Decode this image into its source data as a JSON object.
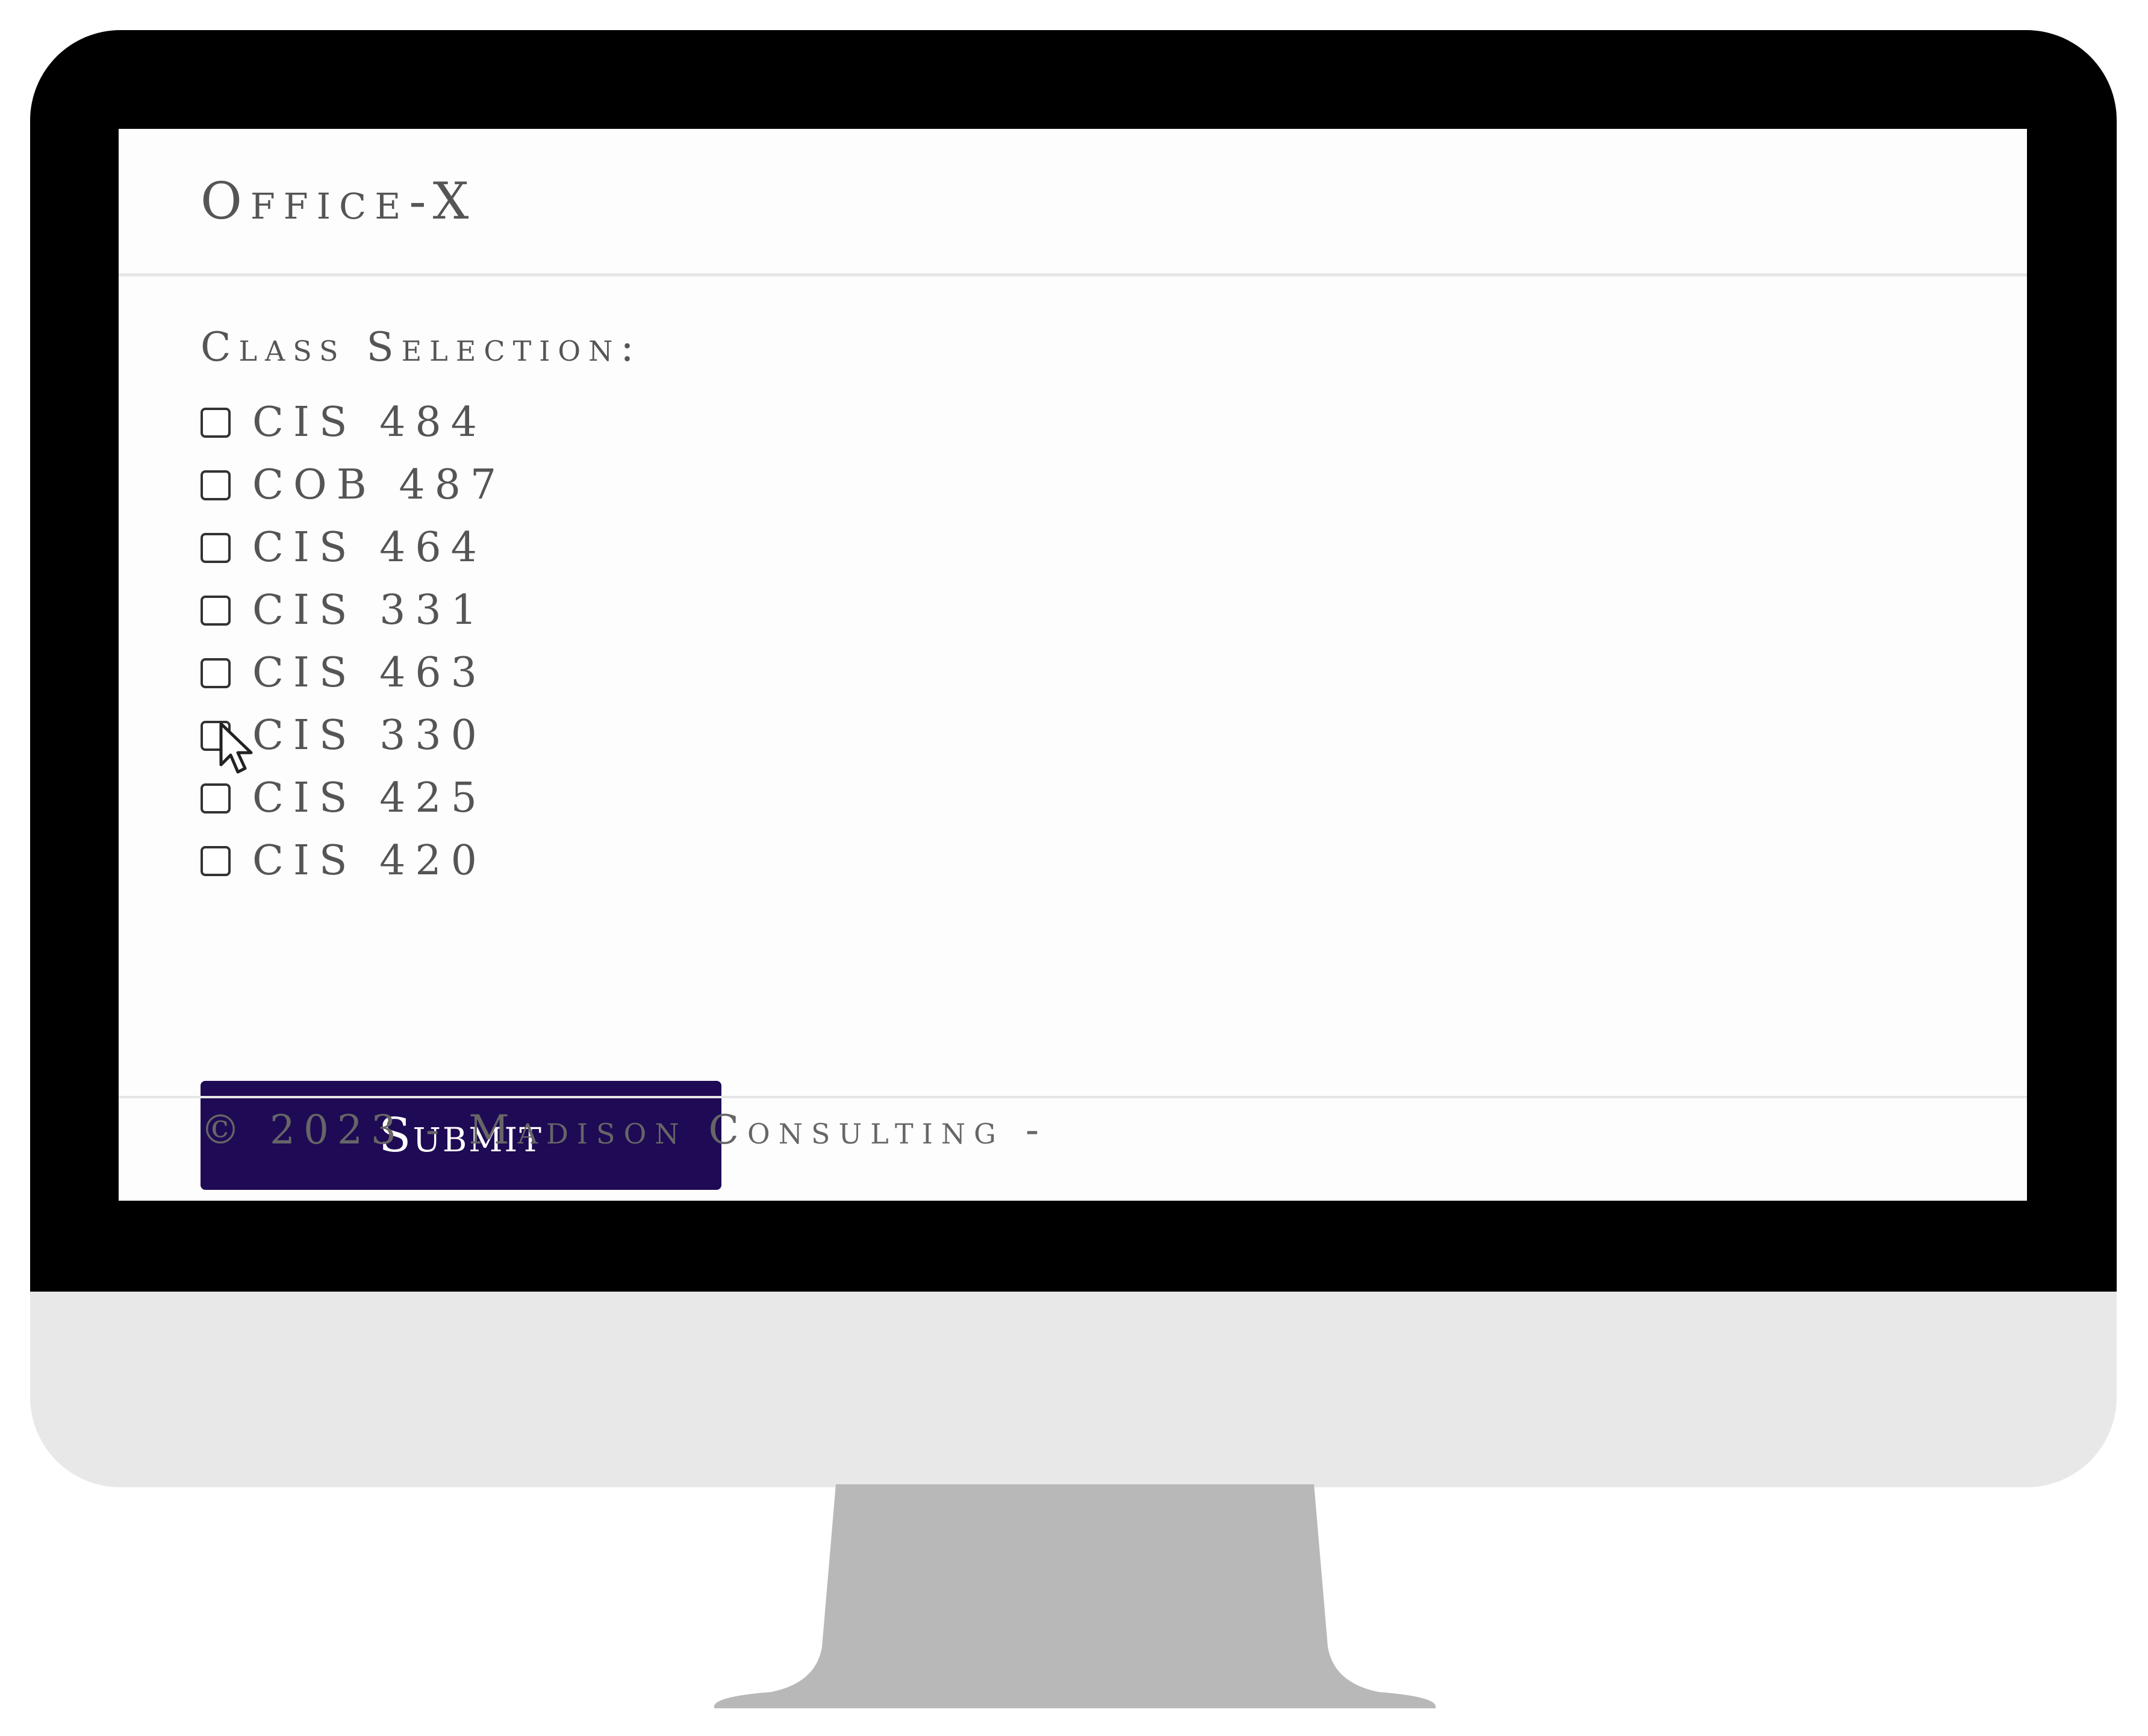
{
  "app": {
    "brand": "Office-X"
  },
  "form": {
    "section_label": "Class Selection:",
    "options": [
      {
        "label": "CIS 484",
        "checked": false
      },
      {
        "label": "COB 487",
        "checked": false
      },
      {
        "label": "CIS 464",
        "checked": false
      },
      {
        "label": "CIS 331",
        "checked": false
      },
      {
        "label": "CIS 463",
        "checked": false
      },
      {
        "label": "CIS 330",
        "checked": false
      },
      {
        "label": "CIS 425",
        "checked": false
      },
      {
        "label": "CIS 420",
        "checked": false
      }
    ],
    "submit_label": "Submit"
  },
  "footer": {
    "text": "© 2023 - Madison Consulting -"
  },
  "colors": {
    "button_bg": "#1f0a55",
    "bezel": "#000000",
    "chin": "#e8e8e8",
    "stand": "#b8b8b8"
  },
  "icons": {
    "pointer": "mouse-pointer-icon"
  }
}
